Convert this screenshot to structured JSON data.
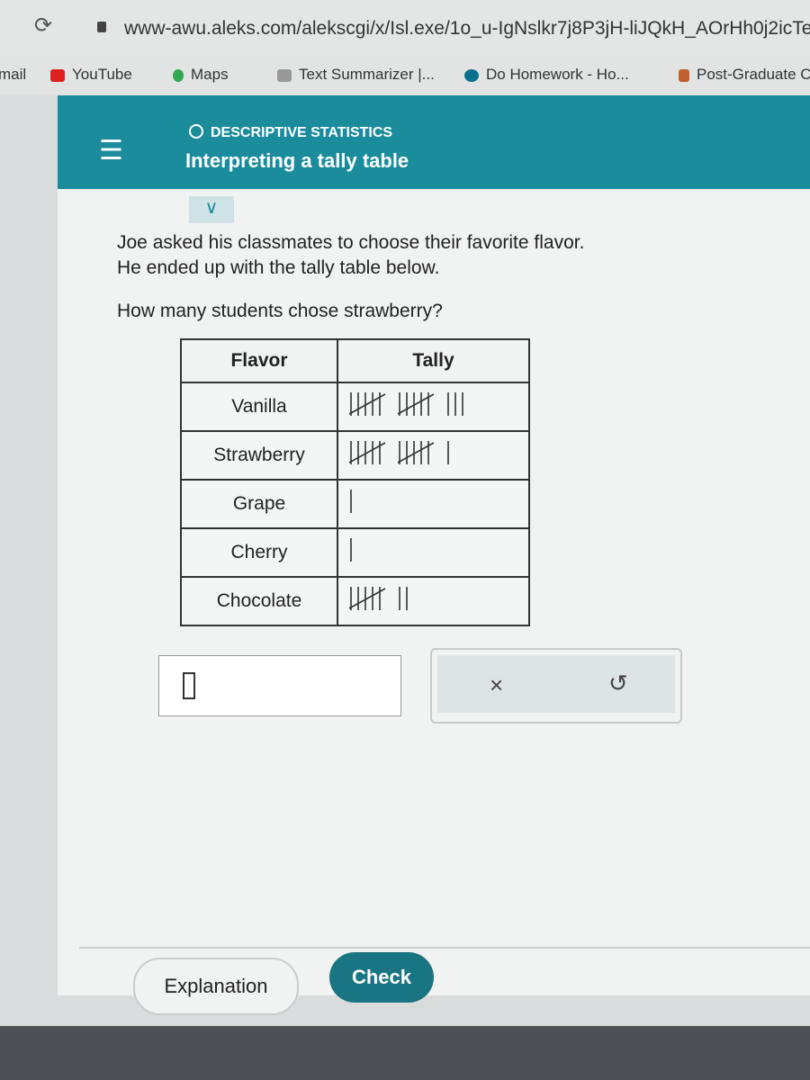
{
  "browser": {
    "url": "www-awu.aleks.com/alekscgi/x/Isl.exe/1o_u-IgNslkr7j8P3jH-liJQkH_AOrHh0j2icTeS",
    "bookmarks": [
      {
        "label": "mail",
        "color": "#e2e4e4"
      },
      {
        "label": "YouTube",
        "color": "#e02020"
      },
      {
        "label": "Maps",
        "color": "#34a853"
      },
      {
        "label": "Text Summarizer |...",
        "color": "#777777"
      },
      {
        "label": "Do Homework - Ho...",
        "color": "#0a6f8c"
      },
      {
        "label": "Post-Graduate C",
        "color": "#c0602a"
      }
    ]
  },
  "header": {
    "topic": "DESCRIPTIVE STATISTICS",
    "title": "Interpreting a tally table"
  },
  "question": {
    "line1": "Joe asked his classmates to choose their favorite flavor.",
    "line2": "He ended up with the tally table below.",
    "line3": "How many students chose strawberry?"
  },
  "table": {
    "headers": [
      "Flavor",
      "Tally"
    ],
    "rows": [
      {
        "flavor": "Vanilla",
        "tally": 13
      },
      {
        "flavor": "Strawberry",
        "tally": 11
      },
      {
        "flavor": "Grape",
        "tally": 1
      },
      {
        "flavor": "Cherry",
        "tally": 1
      },
      {
        "flavor": "Chocolate",
        "tally": 7
      }
    ]
  },
  "answer": {
    "value": ""
  },
  "buttons": {
    "clear": "×",
    "undo": "↺",
    "explanation": "Explanation",
    "check": "Check"
  },
  "colors": {
    "accent": "#1a8c9c",
    "check": "#1a7582"
  }
}
